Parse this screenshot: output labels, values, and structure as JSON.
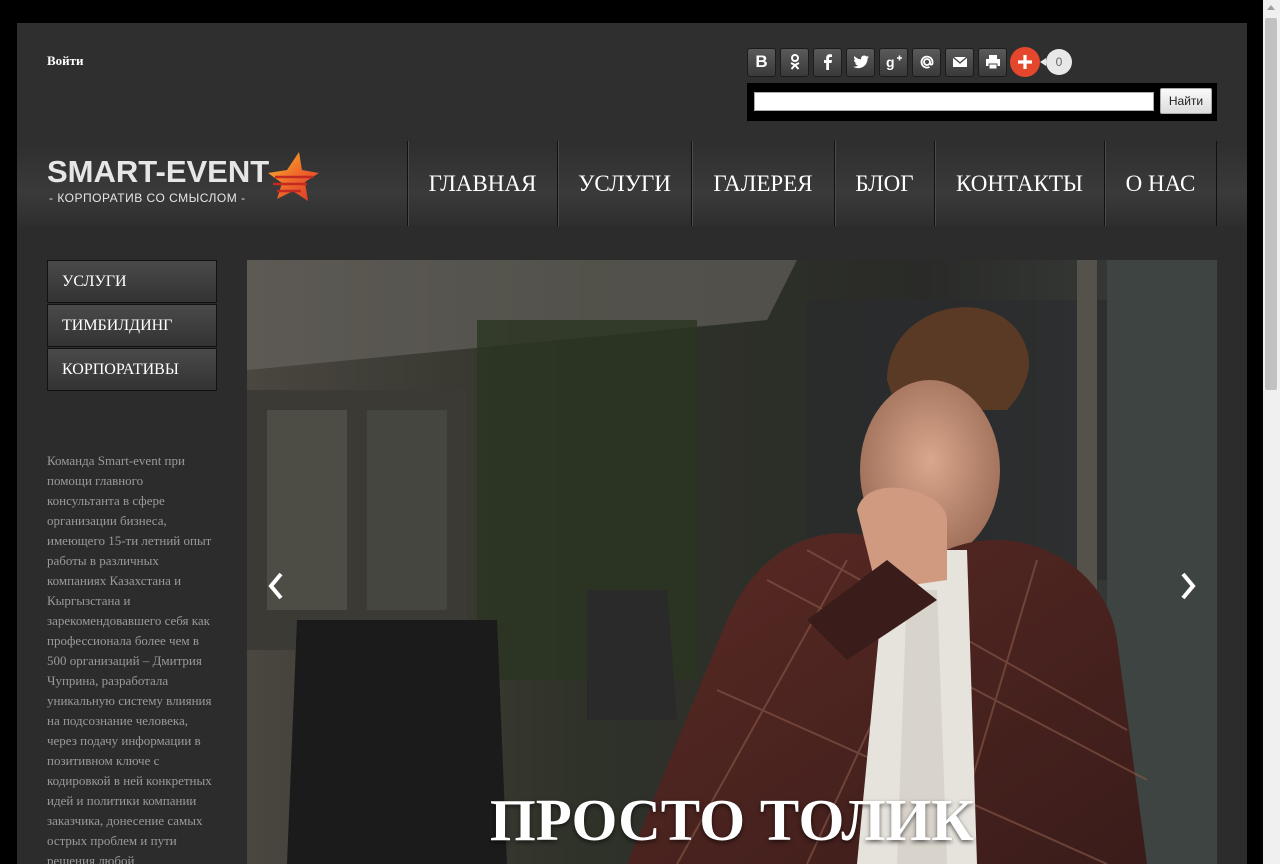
{
  "topbar": {
    "login_label": "Войти",
    "share": {
      "buttons": [
        "vkontakte-icon",
        "odnoklassniki-icon",
        "facebook-icon",
        "twitter-icon",
        "google-plus-icon",
        "mailru-icon",
        "email-icon",
        "print-icon"
      ],
      "vk_glyph": "B",
      "count": "0"
    },
    "search": {
      "value": "",
      "button_label": "Найти"
    }
  },
  "header": {
    "logo_text": "SMART-EVENT",
    "logo_subtitle": "- КОРПОРАТИВ СО СМЫСЛОМ -",
    "nav": [
      "ГЛАВНАЯ",
      "УСЛУГИ",
      "ГАЛЕРЕЯ",
      "БЛОГ",
      "КОНТАКТЫ",
      "О НАС"
    ]
  },
  "sidebar": {
    "menu": [
      "УСЛУГИ",
      "ТИМБИЛДИНГ",
      "КОРПОРАТИВЫ"
    ],
    "text": "Команда Smart-event  при помощи главного консультанта в сфере организации бизнеса, имеющего 15-ти летний опыт работы в различных компаниях Казахстана и Кыргызстана и зарекомендовавшего себя как профессионала более чем в 500 организаций – Дмитрия Чуприна, разработала уникальную систему влияния на подсознание человека, через подачу информации в позитивном ключе с кодировкой в ней конкретных идей и политики компании заказчика, донесение самых острых проблем и пути решения любой"
  },
  "slider": {
    "caption": "ПРОСТО ТОЛИК"
  },
  "colors": {
    "page_bg": "#2c2c2c",
    "accent_star": "#e4472b",
    "share_plus": "#e4472b"
  }
}
